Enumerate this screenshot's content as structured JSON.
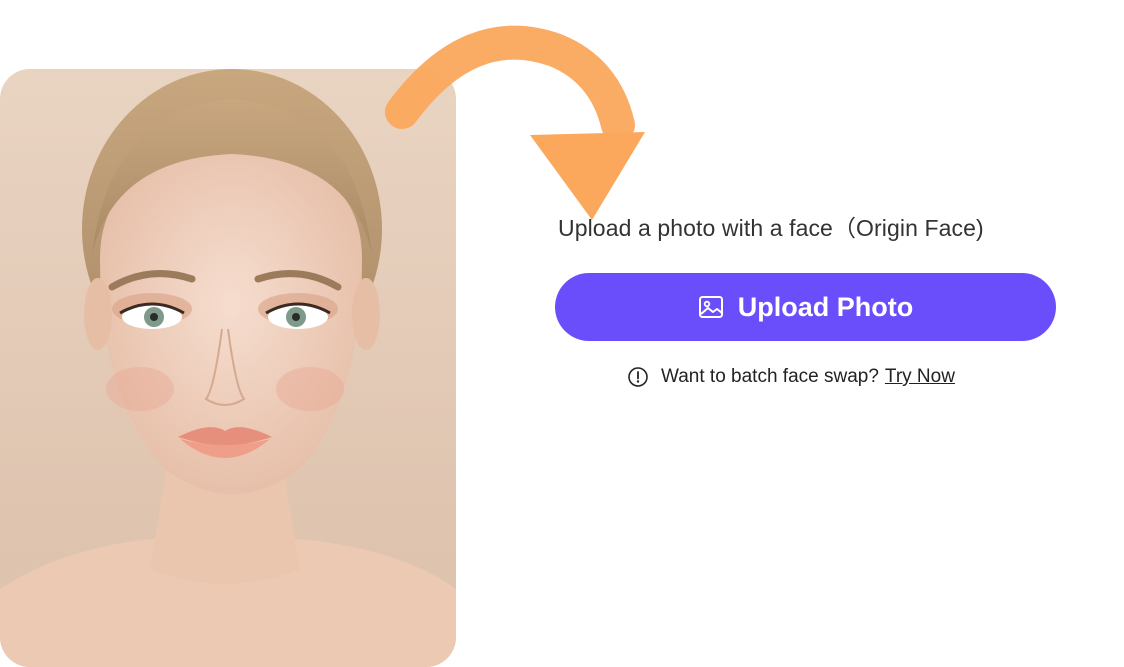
{
  "colors": {
    "accent": "#6a4efc",
    "arrow": "#fba85c",
    "text": "#333333"
  },
  "photo": {
    "icon": "portrait-photo"
  },
  "upload": {
    "instruction": "Upload a photo with a face（Origin Face)",
    "button_label": "Upload Photo",
    "button_icon": "image-icon"
  },
  "batch": {
    "info_icon": "info-icon",
    "prompt": "Want to batch face swap?",
    "link_label": "Try Now"
  }
}
